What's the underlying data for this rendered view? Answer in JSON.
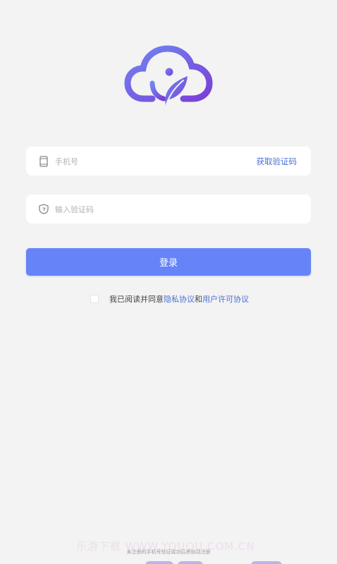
{
  "colors": {
    "background": "#f3f3f3",
    "accent": "#6683f8",
    "link": "#4a6fd8",
    "logo_gradient_start": "#6f86f3",
    "logo_gradient_end": "#7a3fd6"
  },
  "logo": {
    "icon": "cloud-leaf-logo-icon"
  },
  "phone_field": {
    "icon": "phone-icon",
    "placeholder": "手机号",
    "get_code_label": "获取验证码"
  },
  "code_field": {
    "icon": "shield-icon",
    "placeholder": "输入验证码"
  },
  "login_button": {
    "label": "登录"
  },
  "agreement": {
    "checked": false,
    "prefix": "我已阅读并同意",
    "privacy_link": "隐私协议",
    "conjunction": "和",
    "license_link": "用户许可协议"
  },
  "footer": {
    "note": "未注册的手机号验证成功后将自动注册",
    "watermark": "乐游下载 WWW.YOUQU.COM.CN"
  }
}
